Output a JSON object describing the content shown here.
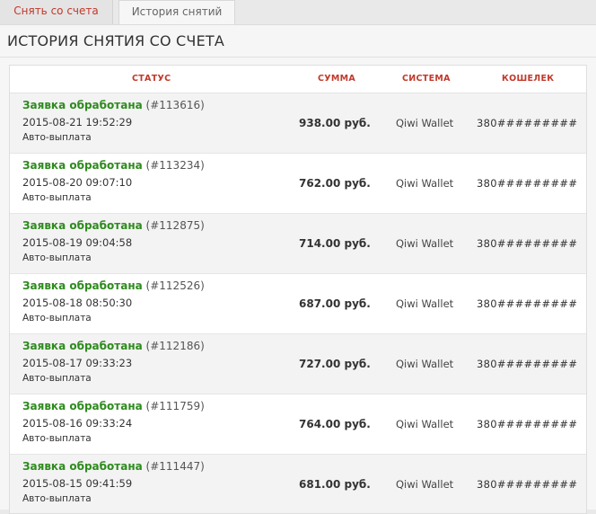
{
  "tabs": [
    {
      "label": "Снять со счета",
      "active": false
    },
    {
      "label": "История снятий",
      "active": true
    }
  ],
  "page": {
    "title": "ИСТОРИЯ СНЯТИЯ СО СЧЕТА"
  },
  "table": {
    "headers": {
      "status": "СТАТУС",
      "sum": "СУММА",
      "system": "СИСТЕМА",
      "wallet": "КОШЕЛЕК"
    },
    "rows": [
      {
        "status": "Заявка обработана",
        "id": "(#113616)",
        "date": "2015-08-21 19:52:29",
        "mode": "Авто-выплата",
        "amount": "938.00 руб.",
        "system": "Qiwi Wallet",
        "wallet": "380#########"
      },
      {
        "status": "Заявка обработана",
        "id": "(#113234)",
        "date": "2015-08-20 09:07:10",
        "mode": "Авто-выплата",
        "amount": "762.00 руб.",
        "system": "Qiwi Wallet",
        "wallet": "380#########"
      },
      {
        "status": "Заявка обработана",
        "id": "(#112875)",
        "date": "2015-08-19 09:04:58",
        "mode": "Авто-выплата",
        "amount": "714.00 руб.",
        "system": "Qiwi Wallet",
        "wallet": "380#########"
      },
      {
        "status": "Заявка обработана",
        "id": "(#112526)",
        "date": "2015-08-18 08:50:30",
        "mode": "Авто-выплата",
        "amount": "687.00 руб.",
        "system": "Qiwi Wallet",
        "wallet": "380#########"
      },
      {
        "status": "Заявка обработана",
        "id": "(#112186)",
        "date": "2015-08-17 09:33:23",
        "mode": "Авто-выплата",
        "amount": "727.00 руб.",
        "system": "Qiwi Wallet",
        "wallet": "380#########"
      },
      {
        "status": "Заявка обработана",
        "id": "(#111759)",
        "date": "2015-08-16 09:33:24",
        "mode": "Авто-выплата",
        "amount": "764.00 руб.",
        "system": "Qiwi Wallet",
        "wallet": "380#########"
      },
      {
        "status": "Заявка обработана",
        "id": "(#111447)",
        "date": "2015-08-15 09:41:59",
        "mode": "Авто-выплата",
        "amount": "681.00 руб.",
        "system": "Qiwi Wallet",
        "wallet": "380#########"
      }
    ]
  },
  "colors": {
    "accent": "#c0392b",
    "status_ok": "#2e8b1e"
  }
}
